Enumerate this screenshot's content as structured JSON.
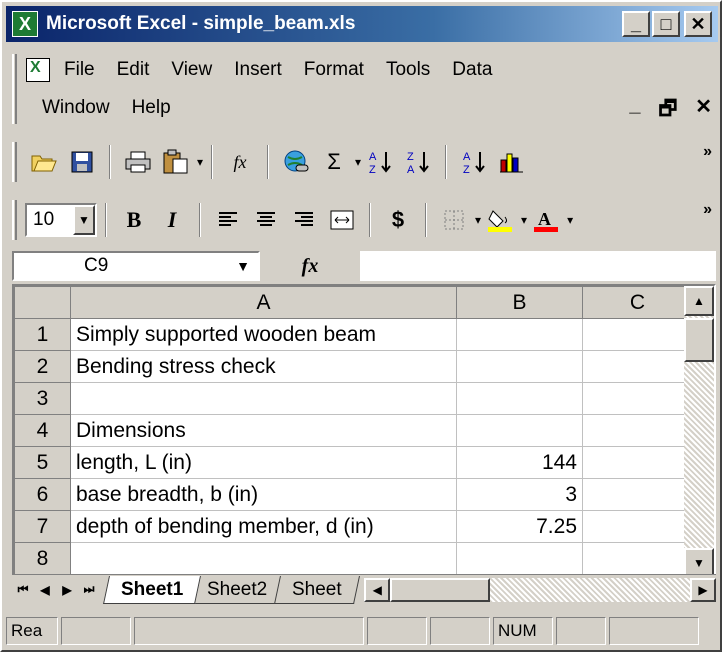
{
  "window": {
    "title": "Microsoft Excel - simple_beam.xls",
    "minimize_glyph": "_",
    "maximize_glyph": "□",
    "close_glyph": "✕"
  },
  "menu": {
    "items": [
      "File",
      "Edit",
      "View",
      "Insert",
      "Format",
      "Tools",
      "Data"
    ],
    "row2_items": [
      "Window",
      "Help"
    ],
    "mdi_minimize": "_",
    "mdi_restore": "🗗",
    "mdi_close": "✕"
  },
  "toolbar_standard": {
    "icons": [
      "open-icon",
      "save-icon",
      "print-icon",
      "paste-icon",
      "function-icon",
      "hyperlink-icon",
      "autosum-icon",
      "sort-ascending-icon",
      "sort-descending-icon",
      "sort-icon",
      "chart-icon"
    ],
    "fx": "fx",
    "sigma": "Σ",
    "overflow": "»"
  },
  "toolbar_formatting": {
    "font_size": "10",
    "bold": "B",
    "italic": "I",
    "currency": "$",
    "font_color_letter": "A",
    "overflow": "»",
    "fill_color": "#ffff00",
    "font_color": "#ff0000"
  },
  "formula_bar": {
    "name_box": "C9",
    "fx": "fx",
    "content": ""
  },
  "grid": {
    "columns": [
      "A",
      "B",
      "C"
    ],
    "rows": [
      {
        "num": "1",
        "a": "Simply supported wooden beam",
        "b": "",
        "c": ""
      },
      {
        "num": "2",
        "a": "Bending stress check",
        "b": "",
        "c": ""
      },
      {
        "num": "3",
        "a": "",
        "b": "",
        "c": ""
      },
      {
        "num": "4",
        "a": "Dimensions",
        "b": "",
        "c": ""
      },
      {
        "num": "5",
        "a": "length, L (in)",
        "b": "144",
        "c": ""
      },
      {
        "num": "6",
        "a": "base breadth, b (in)",
        "b": "3",
        "c": ""
      },
      {
        "num": "7",
        "a": "depth of bending member, d (in)",
        "b": "7.25",
        "c": ""
      },
      {
        "num": "8",
        "a": "",
        "b": "",
        "c": ""
      }
    ]
  },
  "sheet_tabs": [
    "Sheet1",
    "Sheet2",
    "Sheet"
  ],
  "status": {
    "left": "Rea",
    "num": "NUM"
  }
}
